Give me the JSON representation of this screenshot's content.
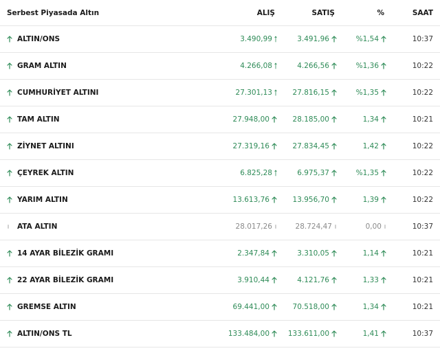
{
  "header": {
    "title": "Serbest Piyasada Altın",
    "col_alis": "ALIŞ",
    "col_satis": "SATIŞ",
    "col_pct": "%",
    "col_saat": "SAAT"
  },
  "colors": {
    "up": "#2e8b57",
    "flat": "#8a8a8a",
    "text": "#1a1a1a",
    "divider": "#e6e6e6"
  },
  "rows": [
    {
      "name": "ALTIN/ONS",
      "alis": "3.490,99",
      "satis": "3.491,96",
      "pct": "%1,54",
      "saat": "10:37",
      "trend": "up",
      "alis_icon": "thin-up-arrow-icon",
      "satis_icon": "up-arrow-icon"
    },
    {
      "name": "GRAM ALTIN",
      "alis": "4.266,08",
      "satis": "4.266,56",
      "pct": "%1,36",
      "saat": "10:22",
      "trend": "up",
      "alis_icon": "thin-up-arrow-icon",
      "satis_icon": "up-arrow-icon"
    },
    {
      "name": "CUMHURİYET ALTINI",
      "alis": "27.301,13",
      "satis": "27.816,15",
      "pct": "%1,35",
      "saat": "10:22",
      "trend": "up",
      "alis_icon": "thin-up-arrow-icon",
      "satis_icon": "up-arrow-icon"
    },
    {
      "name": "TAM ALTIN",
      "alis": "27.948,00",
      "satis": "28.185,00",
      "pct": "1,34",
      "saat": "10:21",
      "trend": "up",
      "alis_icon": "up-arrow-icon",
      "satis_icon": "up-arrow-icon"
    },
    {
      "name": "ZİYNET ALTINI",
      "alis": "27.319,16",
      "satis": "27.834,45",
      "pct": "1,42",
      "saat": "10:22",
      "trend": "up",
      "alis_icon": "up-arrow-icon",
      "satis_icon": "up-arrow-icon"
    },
    {
      "name": "ÇEYREK ALTIN",
      "alis": "6.825,28",
      "satis": "6.975,37",
      "pct": "%1,35",
      "saat": "10:22",
      "trend": "up",
      "alis_icon": "thin-up-arrow-icon",
      "satis_icon": "up-arrow-icon"
    },
    {
      "name": "YARIM ALTIN",
      "alis": "13.613,76",
      "satis": "13.956,70",
      "pct": "1,39",
      "saat": "10:22",
      "trend": "up",
      "alis_icon": "up-arrow-icon",
      "satis_icon": "up-arrow-icon"
    },
    {
      "name": "ATA ALTIN",
      "alis": "28.017,26",
      "satis": "28.724,47",
      "pct": "0,00",
      "saat": "10:37",
      "trend": "flat",
      "alis_icon": "flat-icon",
      "satis_icon": "flat-icon"
    },
    {
      "name": "14 AYAR BİLEZİK GRAMI",
      "alis": "2.347,84",
      "satis": "3.310,05",
      "pct": "1,14",
      "saat": "10:21",
      "trend": "up",
      "alis_icon": "up-arrow-icon",
      "satis_icon": "up-arrow-icon"
    },
    {
      "name": "22 AYAR BİLEZİK GRAMI",
      "alis": "3.910,44",
      "satis": "4.121,76",
      "pct": "1,33",
      "saat": "10:21",
      "trend": "up",
      "alis_icon": "up-arrow-icon",
      "satis_icon": "up-arrow-icon"
    },
    {
      "name": "GREMSE ALTIN",
      "alis": "69.441,00",
      "satis": "70.518,00",
      "pct": "1,34",
      "saat": "10:21",
      "trend": "up",
      "alis_icon": "up-arrow-icon",
      "satis_icon": "up-arrow-icon"
    },
    {
      "name": "ALTIN/ONS TL",
      "alis": "133.484,00",
      "satis": "133.611,00",
      "pct": "1,41",
      "saat": "10:37",
      "trend": "up",
      "alis_icon": "up-arrow-icon",
      "satis_icon": "up-arrow-icon"
    }
  ]
}
